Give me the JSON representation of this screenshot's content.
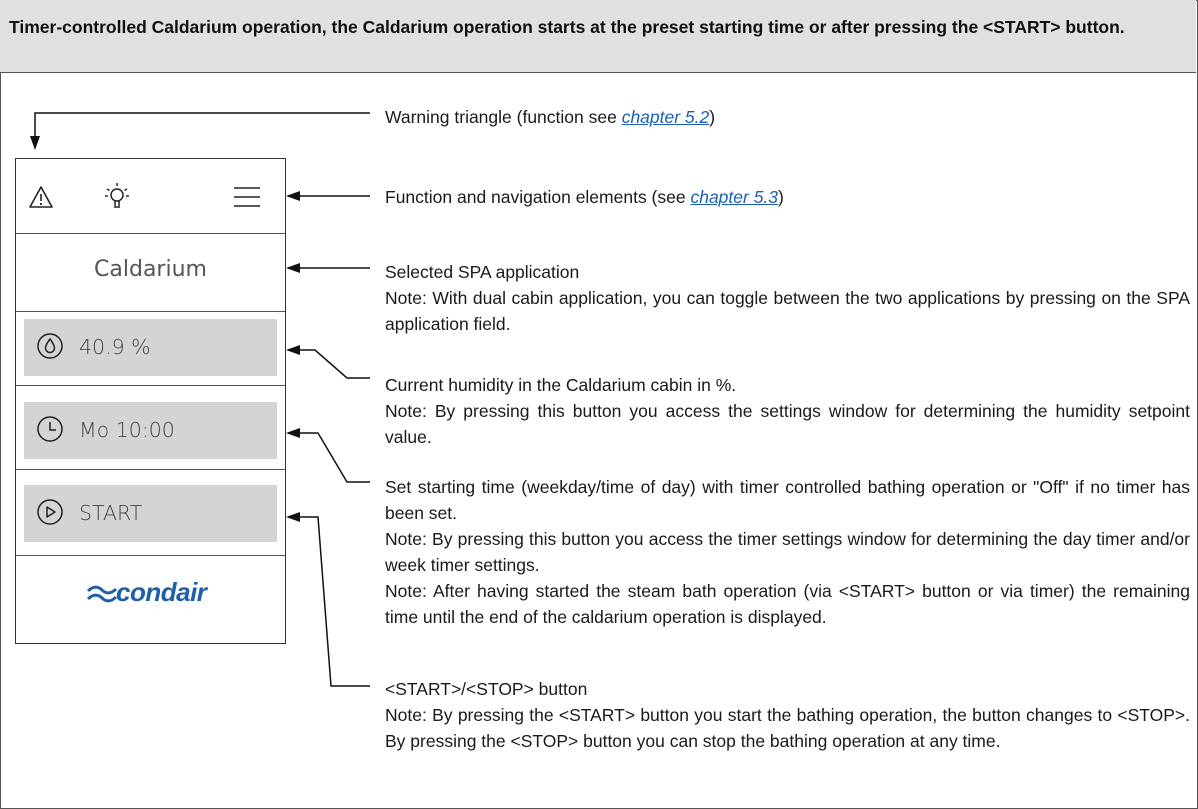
{
  "header": {
    "title": "Timer-controlled Caldarium operation, the Caldarium operation starts at the preset starting time or after pressing the <START> button."
  },
  "device": {
    "app_name": "Caldarium",
    "humidity_value": "40.9 %",
    "start_time_value": "Mo 10:00",
    "start_button_label": "START",
    "brand": "condair",
    "icons": [
      "warning-icon",
      "light-bulb-icon",
      "menu-icon",
      "humidity-drop-icon",
      "clock-icon",
      "play-icon"
    ]
  },
  "descriptions": {
    "warning": {
      "prefix": "Warning triangle (function see ",
      "link": "chapter 5.2",
      "suffix": ")"
    },
    "function_nav": {
      "prefix": "Function and navigation elements (see ",
      "link": "chapter 5.3",
      "suffix": ")"
    },
    "spa_app": {
      "line1": "Selected SPA application",
      "note": "Note: With dual cabin application, you can toggle between the two applications by pressing on the SPA application field."
    },
    "humidity": {
      "line1": "Current humidity in the Caldarium cabin in %.",
      "note": "Note: By pressing this button you access the settings window for determining the humidity setpoint value."
    },
    "start_time": {
      "line1": "Set starting time (weekday/time of day) with timer controlled bathing operation or \"Off\" if no timer has been set.",
      "note1": "Note: By pressing this button you access the timer settings window for deter­mining the day timer and/or week timer settings.",
      "note2": "Note: After having started the steam bath operation (via <START> button or via timer) the remaining time until the end of the caldarium operation is displayed."
    },
    "start_stop": {
      "line1": "<START>/<STOP> button",
      "note": "Note: By pressing the <START> button you start the bathing operation, the button changes to <STOP>. By pressing the <STOP> button you can stop the bathing operation at any time."
    }
  },
  "colors": {
    "link": "#1a5fb4",
    "header_bg": "#e0e0e0",
    "button_bg": "#d4d4d4",
    "brand": "#1f5fa8"
  }
}
